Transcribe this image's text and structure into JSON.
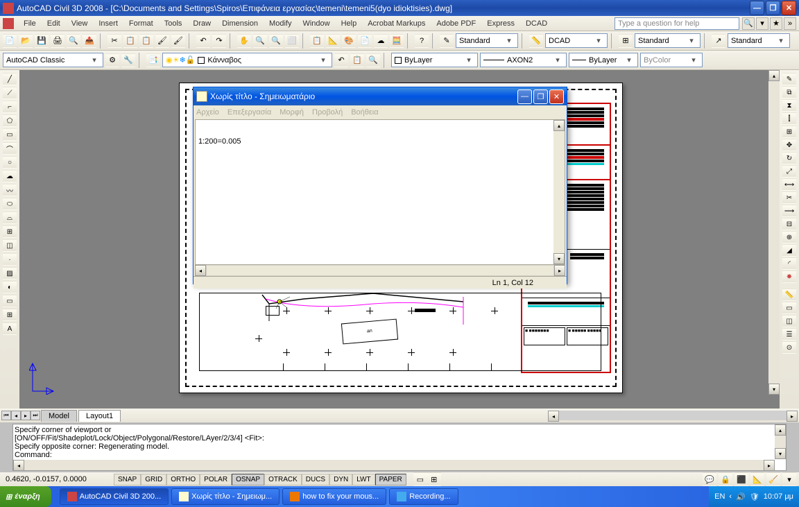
{
  "app": {
    "title": "AutoCAD Civil 3D 2008 - [C:\\Documents and Settings\\Spiros\\Επιφάνεια εργασίας\\temeni\\temeni5(dyo idioktisies).dwg]"
  },
  "menu": {
    "items": [
      "File",
      "Edit",
      "View",
      "Insert",
      "Format",
      "Tools",
      "Draw",
      "Dimension",
      "Modify",
      "Window",
      "Help",
      "Acrobat Markups",
      "Adobe PDF",
      "Express",
      "DCAD"
    ],
    "help_placeholder": "Type a question for help"
  },
  "toolbar1": {
    "standard_combo": "Standard",
    "dcad_combo": "DCAD",
    "standard_combo2": "Standard",
    "standard_combo3": "Standard"
  },
  "toolbar2": {
    "workspace": "AutoCAD Classic",
    "layer": "Κάνναβος",
    "linetype1": "ByLayer",
    "linetype2": "AXON2",
    "linetype3": "ByLayer",
    "linetype4": "ByColor"
  },
  "tabs": {
    "model": "Model",
    "layout1": "Layout1"
  },
  "command": {
    "line1": "Specify corner of viewport or",
    "line2": "[ON/OFF/Fit/Shadeplot/Lock/Object/Polygonal/Restore/LAyer/2/3/4] <Fit>:",
    "line3": "Specify opposite corner: Regenerating model.",
    "prompt": "Command:"
  },
  "status": {
    "coords": "0.4620, -0.0157, 0.0000",
    "buttons": [
      "SNAP",
      "GRID",
      "ORTHO",
      "POLAR",
      "OSNAP",
      "OTRACK",
      "DUCS",
      "DYN",
      "LWT",
      "PAPER"
    ]
  },
  "notepad": {
    "title": "Χωρίς τίτλο - Σημειωματάριο",
    "menu": [
      "Αρχείο",
      "Επεξεργασία",
      "Μορφή",
      "Προβολή",
      "Βοήθεια"
    ],
    "content": "1:200=0.005",
    "status": "Ln 1, Col 12"
  },
  "taskbar": {
    "start": "έναρξη",
    "items": [
      "AutoCAD Civil 3D 200...",
      "Χωρίς τίτλο - Σημειωμ...",
      "how to fix your mous...",
      "Recording..."
    ],
    "lang": "EN",
    "time": "10:07 μμ"
  },
  "titleblock": {
    "label": "an"
  }
}
